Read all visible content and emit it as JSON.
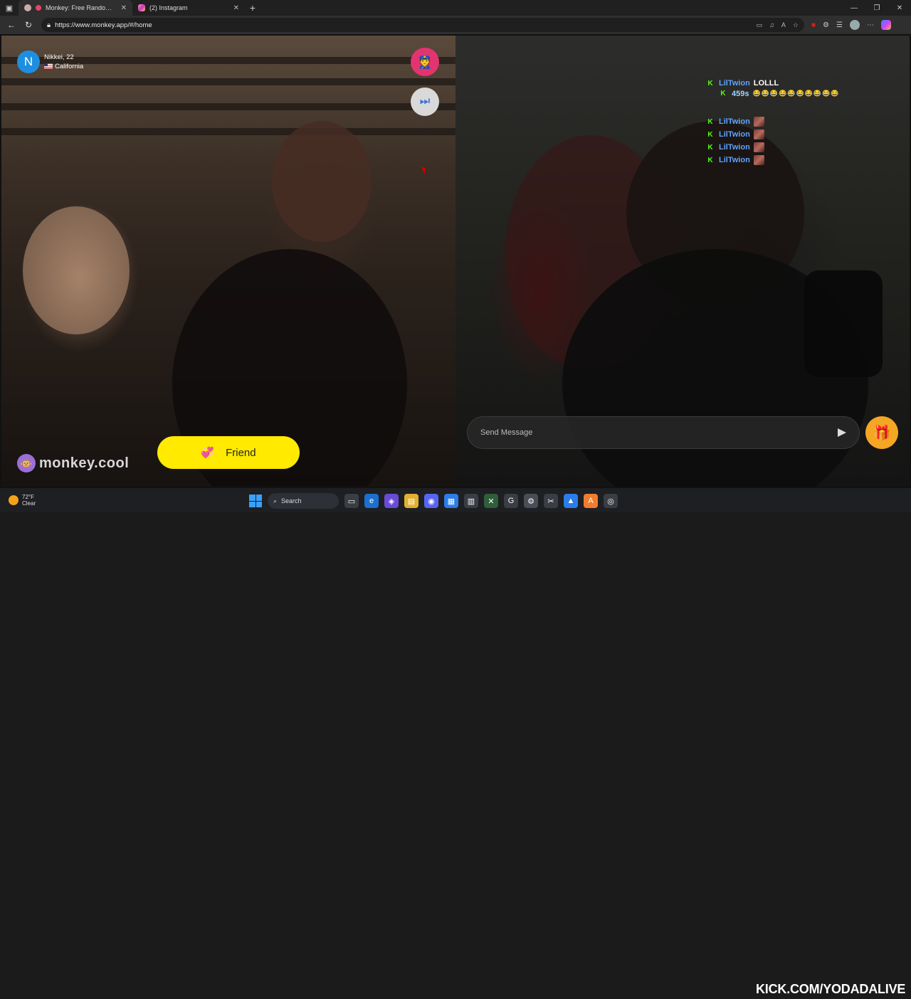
{
  "browser": {
    "tabs": [
      {
        "title": "Monkey: Free Random Video Chat",
        "active": true
      },
      {
        "title": "(2) Instagram",
        "active": false
      }
    ],
    "url": "https://www.monkey.app/#/home"
  },
  "left_video": {
    "user_initial": "N",
    "user_name": "Nikkei, 22",
    "user_location": "California",
    "friend_label": "Friend",
    "brand": "monkey.cool"
  },
  "chat": {
    "messages": [
      {
        "user": "LilTwion",
        "text": "LOLLL"
      },
      {
        "user": "459s",
        "text": "😂😂😂😂😂😂😂😂😂😂"
      },
      {
        "user": "LilTwion",
        "text": ""
      },
      {
        "user": "LilTwion",
        "text": ""
      },
      {
        "user": "LilTwion",
        "text": ""
      },
      {
        "user": "LilTwion",
        "text": ""
      }
    ],
    "placeholder": "Send Message"
  },
  "taskbar": {
    "temperature": "72°F",
    "condition": "Clear",
    "search_label": "Search"
  },
  "overlay": {
    "banner": "KICK.COM/YODADALIVE"
  },
  "colors": {
    "report": "#e33470",
    "friend": "#ffea00",
    "gift": "#f5a623",
    "kick_green": "#53fc18",
    "chat_user": "#5fa3ff"
  }
}
